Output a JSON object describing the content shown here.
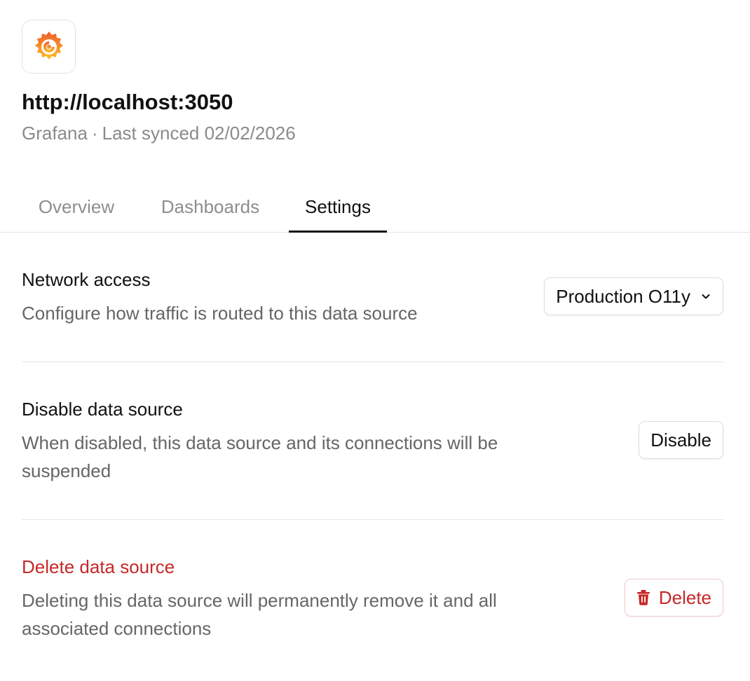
{
  "header": {
    "logo_icon": "grafana-logo-icon",
    "title": "http://localhost:3050",
    "source_type": "Grafana",
    "separator": "·",
    "last_synced": "Last synced 02/02/2026"
  },
  "tabs": [
    {
      "label": "Overview",
      "active": false
    },
    {
      "label": "Dashboards",
      "active": false
    },
    {
      "label": "Settings",
      "active": true
    }
  ],
  "settings": {
    "network_access": {
      "title": "Network access",
      "description": "Configure how traffic is routed to this data source",
      "select_value": "Production O11y",
      "select_icon": "chevron-down-icon"
    },
    "disable": {
      "title": "Disable data source",
      "description": "When disabled, this data source and its connections will be suspended",
      "button_label": "Disable"
    },
    "delete": {
      "title": "Delete data source",
      "description": "Deleting this data source will permanently remove it and all associated connections",
      "button_label": "Delete",
      "button_icon": "trash-icon"
    }
  },
  "colors": {
    "danger": "#c62828",
    "muted_text": "#666666",
    "border": "#e4e4e7",
    "logo_orange": "#f46800",
    "logo_yellow": "#fbc02d"
  }
}
